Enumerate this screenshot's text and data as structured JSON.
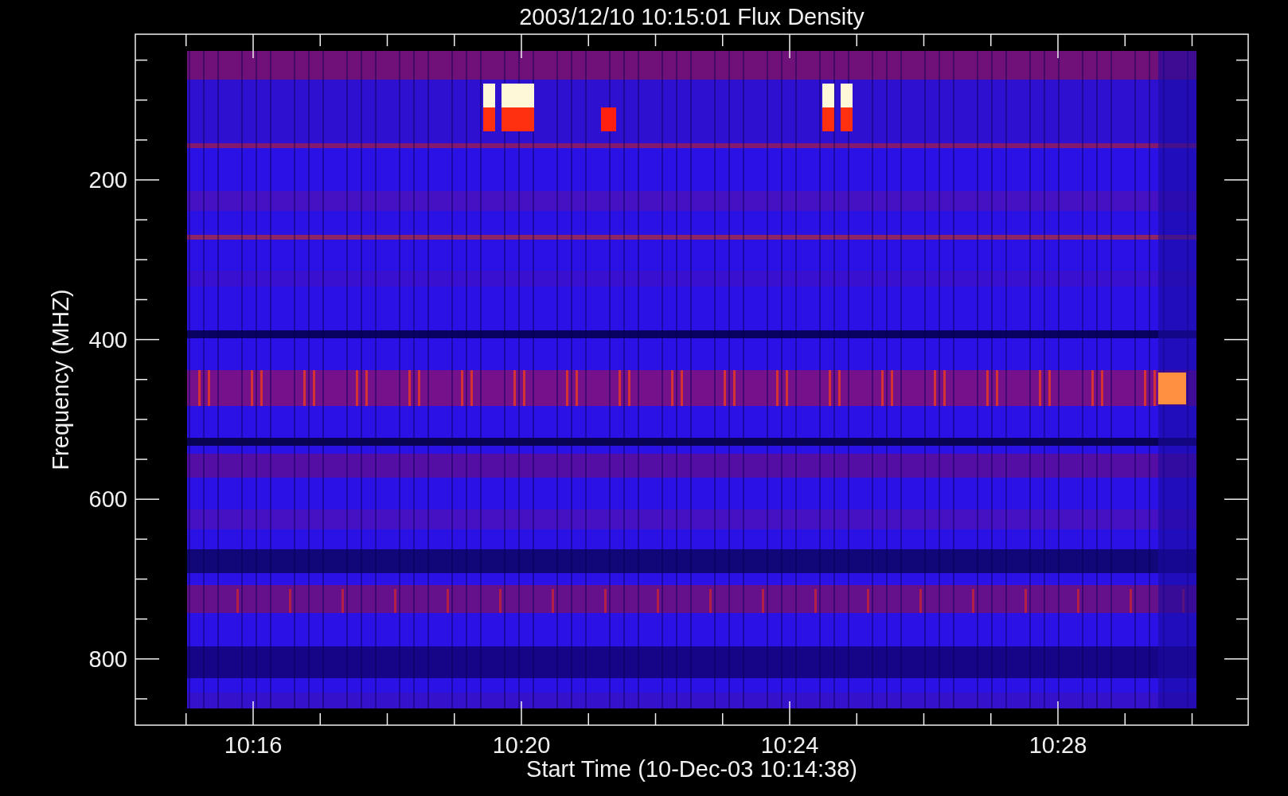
{
  "title": "2003/12/10 10:15:01 Flux Density",
  "y_axis": {
    "label": "Frequency (MHZ)",
    "ticks": [
      "200",
      "400",
      "600",
      "800"
    ]
  },
  "x_axis": {
    "label": "Start Time (10-Dec-03 10:14:38)",
    "ticks": [
      "10:16",
      "10:20",
      "10:24",
      "10:28"
    ]
  }
}
